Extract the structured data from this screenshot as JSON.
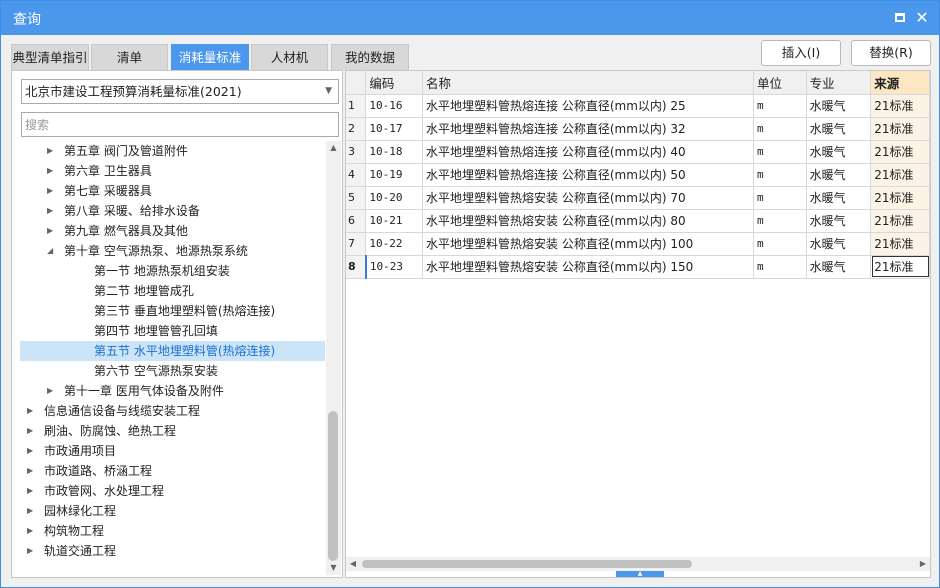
{
  "window": {
    "title": "查询"
  },
  "tabs": [
    {
      "label": "典型清单指引",
      "active": false
    },
    {
      "label": "清单",
      "active": false
    },
    {
      "label": "消耗量标准",
      "active": true
    },
    {
      "label": "人材机",
      "active": false
    },
    {
      "label": "我的数据",
      "active": false
    }
  ],
  "actions": {
    "insert": "插入(I)",
    "replace": "替换(R)"
  },
  "left": {
    "standard_select": "北京市建设工程预算消耗量标准(2021)",
    "search_placeholder": "搜索",
    "tree": [
      {
        "label": "第五章 阀门及管道附件",
        "level": 1,
        "state": "collapsed"
      },
      {
        "label": "第六章 卫生器具",
        "level": 1,
        "state": "collapsed"
      },
      {
        "label": "第七章 采暖器具",
        "level": 1,
        "state": "collapsed"
      },
      {
        "label": "第八章 采暖、给排水设备",
        "level": 1,
        "state": "collapsed"
      },
      {
        "label": "第九章 燃气器具及其他",
        "level": 1,
        "state": "collapsed"
      },
      {
        "label": "第十章 空气源热泵、地源热泵系统",
        "level": 1,
        "state": "expanded"
      },
      {
        "label": "第一节 地源热泵机组安装",
        "level": 2,
        "state": "leaf"
      },
      {
        "label": "第二节 地埋管成孔",
        "level": 2,
        "state": "leaf"
      },
      {
        "label": "第三节 垂直地埋塑料管(热熔连接)",
        "level": 2,
        "state": "leaf"
      },
      {
        "label": "第四节 地埋管管孔回填",
        "level": 2,
        "state": "leaf"
      },
      {
        "label": "第五节 水平地埋塑料管(热熔连接)",
        "level": 2,
        "state": "leaf",
        "selected": true
      },
      {
        "label": "第六节 空气源热泵安装",
        "level": 2,
        "state": "leaf"
      },
      {
        "label": "第十一章 医用气体设备及附件",
        "level": 1,
        "state": "collapsed"
      },
      {
        "label": "信息通信设备与线缆安装工程",
        "level": 0,
        "state": "collapsed"
      },
      {
        "label": "刷油、防腐蚀、绝热工程",
        "level": 0,
        "state": "collapsed"
      },
      {
        "label": "市政通用项目",
        "level": 0,
        "state": "collapsed"
      },
      {
        "label": "市政道路、桥涵工程",
        "level": 0,
        "state": "collapsed"
      },
      {
        "label": "市政管网、水处理工程",
        "level": 0,
        "state": "collapsed"
      },
      {
        "label": "园林绿化工程",
        "level": 0,
        "state": "collapsed"
      },
      {
        "label": "构筑物工程",
        "level": 0,
        "state": "collapsed"
      },
      {
        "label": "轨道交通工程",
        "level": 0,
        "state": "collapsed"
      }
    ]
  },
  "grid": {
    "columns": [
      "",
      "编码",
      "名称",
      "单位",
      "专业",
      "来源"
    ],
    "rows": [
      {
        "num": "1",
        "code": "10-16",
        "name": "水平地埋塑料管热熔连接 公称直径(mm以内) 25",
        "unit": "m",
        "major": "水暖气",
        "source": "21标准"
      },
      {
        "num": "2",
        "code": "10-17",
        "name": "水平地埋塑料管热熔连接 公称直径(mm以内) 32",
        "unit": "m",
        "major": "水暖气",
        "source": "21标准"
      },
      {
        "num": "3",
        "code": "10-18",
        "name": "水平地埋塑料管热熔连接 公称直径(mm以内) 40",
        "unit": "m",
        "major": "水暖气",
        "source": "21标准"
      },
      {
        "num": "4",
        "code": "10-19",
        "name": "水平地埋塑料管热熔连接 公称直径(mm以内) 50",
        "unit": "m",
        "major": "水暖气",
        "source": "21标准"
      },
      {
        "num": "5",
        "code": "10-20",
        "name": "水平地埋塑料管热熔安装 公称直径(mm以内) 70",
        "unit": "m",
        "major": "水暖气",
        "source": "21标准"
      },
      {
        "num": "6",
        "code": "10-21",
        "name": "水平地埋塑料管热熔安装 公称直径(mm以内) 80",
        "unit": "m",
        "major": "水暖气",
        "source": "21标准"
      },
      {
        "num": "7",
        "code": "10-22",
        "name": "水平地埋塑料管热熔安装 公称直径(mm以内) 100",
        "unit": "m",
        "major": "水暖气",
        "source": "21标准"
      },
      {
        "num": "8",
        "code": "10-23",
        "name": "水平地埋塑料管热熔安装 公称直径(mm以内) 150",
        "unit": "m",
        "major": "水暖气",
        "source": "21标准",
        "active": true
      }
    ]
  },
  "colors": {
    "accent": "#4a97ec",
    "selected_bg": "#cce4f7",
    "source_header": "#fde6c4"
  }
}
